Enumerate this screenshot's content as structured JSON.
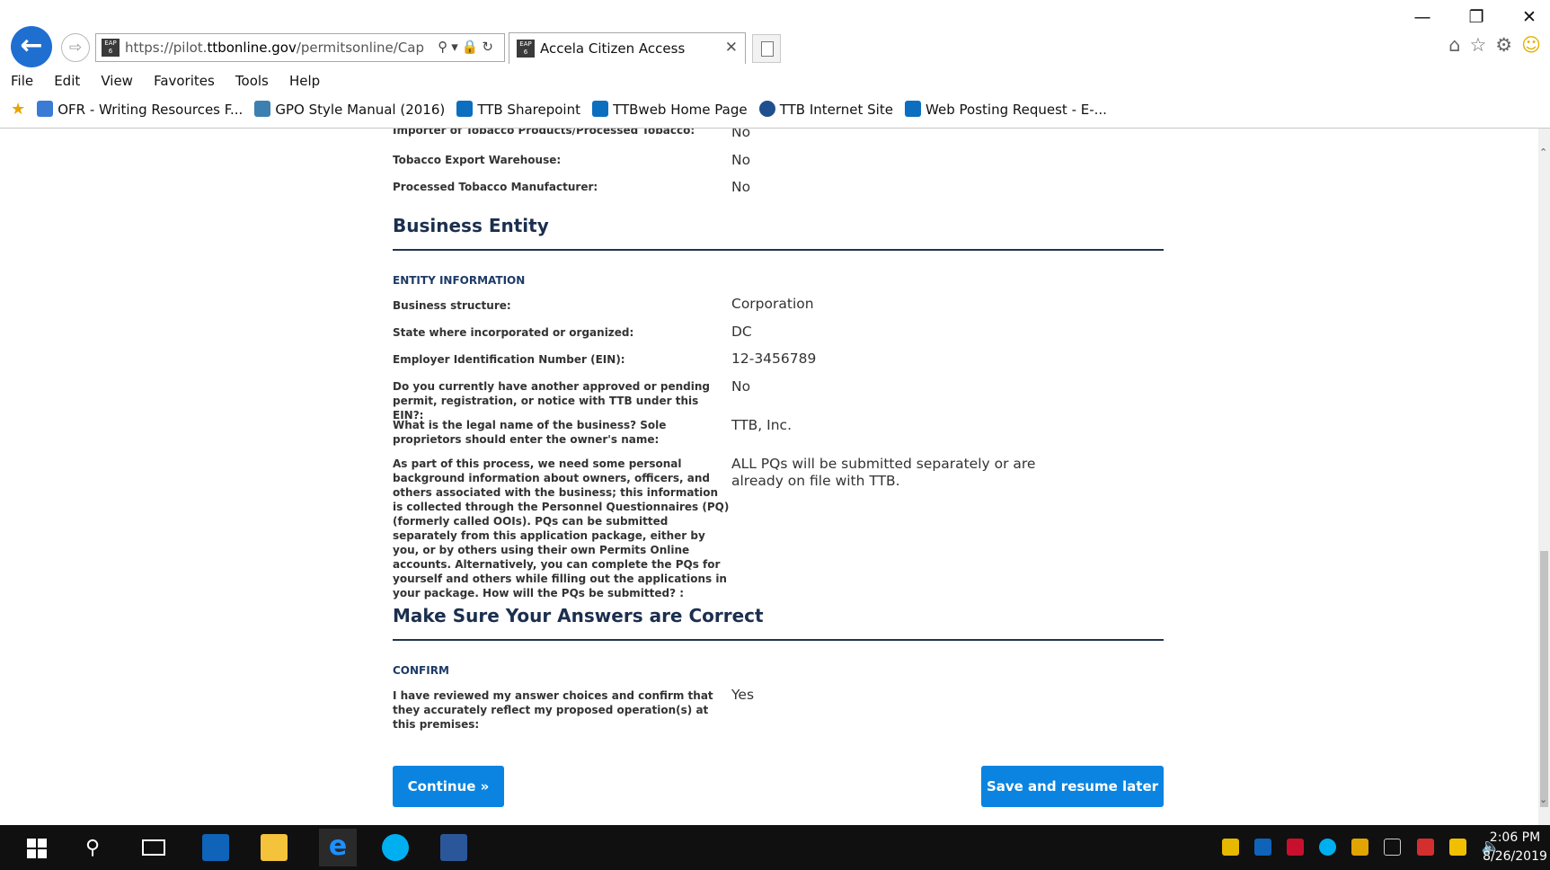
{
  "browser": {
    "url_prefix": "https://pilot.",
    "url_domain": "ttbonline.gov",
    "url_path": "/permitsonline/Cap",
    "tab_title": "Accela Citizen Access",
    "favicon_text": "EAP 6",
    "window_controls": [
      "—",
      "❐",
      "✕"
    ],
    "menu": [
      "File",
      "Edit",
      "View",
      "Favorites",
      "Tools",
      "Help"
    ],
    "favorites": [
      {
        "label": "OFR - Writing Resources F...",
        "icon": "ofr-icon",
        "color": "#3a7bd5"
      },
      {
        "label": "GPO Style Manual (2016)",
        "icon": "gpo-icon",
        "color": "#3c7fb1"
      },
      {
        "label": "TTB Sharepoint",
        "icon": "sharepoint-icon",
        "color": "#0b6ebf"
      },
      {
        "label": "TTBweb Home Page",
        "icon": "sharepoint-icon",
        "color": "#0b6ebf"
      },
      {
        "label": "TTB Internet Site",
        "icon": "ttb-seal-icon",
        "color": "#1f4f8f"
      },
      {
        "label": "Web Posting Request - E-...",
        "icon": "sharepoint-icon",
        "color": "#0b6ebf"
      }
    ]
  },
  "page": {
    "top_rows": [
      {
        "q": "Importer of Tobacco Products/Processed Tobacco:",
        "a": "No"
      },
      {
        "q": "Tobacco Export Warehouse:",
        "a": "No"
      },
      {
        "q": "Processed Tobacco Manufacturer:",
        "a": "No"
      }
    ],
    "business_entity": {
      "title": "Business Entity",
      "subheading": "ENTITY INFORMATION",
      "rows": [
        {
          "q": "Business structure:",
          "a": "Corporation"
        },
        {
          "q": "State where incorporated or organized:",
          "a": "DC"
        },
        {
          "q": "Employer Identification Number (EIN):",
          "a": "12-3456789"
        },
        {
          "q": "Do you currently have another approved or pending permit, registration, or notice with TTB under this EIN?:",
          "a": "No"
        },
        {
          "q": "What is the legal name of the business? Sole proprietors should enter the owner's name:",
          "a": "TTB, Inc."
        },
        {
          "q": "As part of this process, we need some personal background information about owners, officers, and others associated with the business; this information is collected through the Personnel Questionnaires (PQ) (formerly called OOIs). PQs can be submitted separately from this application package, either by you, or by others using their own Permits Online accounts. Alternatively, you can complete the PQs for yourself and others while filling out the applications in your package. How will the PQs be submitted? :",
          "a": "ALL PQs will be submitted separately or are already on file with TTB."
        }
      ]
    },
    "confirm_section": {
      "title": "Make Sure Your Answers are Correct",
      "subheading": "CONFIRM",
      "rows": [
        {
          "q": "I have reviewed my answer choices and confirm that they accurately reflect my proposed operation(s) at this premises:",
          "a": "Yes"
        }
      ]
    },
    "buttons": {
      "continue": "Continue »",
      "save": "Save and resume later"
    }
  },
  "taskbar": {
    "time": "2:06 PM",
    "date": "8/26/2019"
  },
  "colors": {
    "accent_button": "#0a84e0",
    "section_title": "#1b2f4e",
    "back_button": "#1f6fd1"
  }
}
